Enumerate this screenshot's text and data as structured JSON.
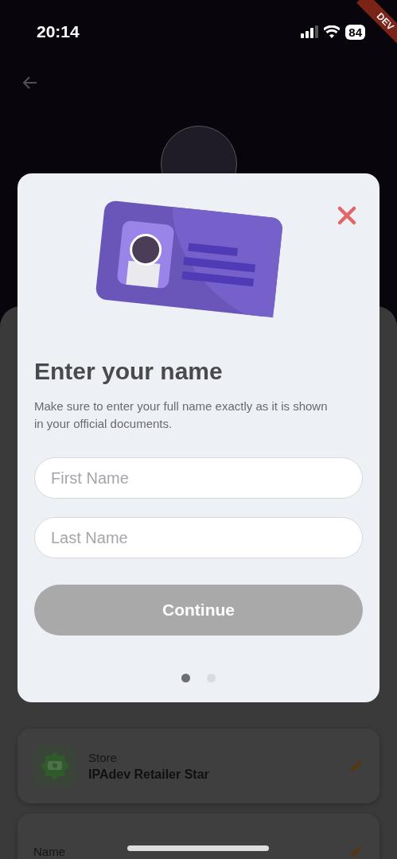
{
  "status_bar": {
    "time": "20:14",
    "battery": "84"
  },
  "dev_ribbon": "DEV",
  "background": {
    "cards": [
      {
        "label": "Store",
        "value": "IPAdev Retailer Star",
        "kind": "store"
      },
      {
        "label": "Name",
        "kind": "plain"
      }
    ]
  },
  "modal": {
    "title": "Enter your name",
    "description": "Make sure to enter your full name exactly as it is shown in your official documents.",
    "fields": [
      {
        "placeholder": "First Name"
      },
      {
        "placeholder": "Last Name"
      }
    ],
    "button": {
      "label": "Continue",
      "disabled": true
    },
    "pages": [
      {
        "selected": true
      },
      {
        "selected": false
      }
    ]
  }
}
